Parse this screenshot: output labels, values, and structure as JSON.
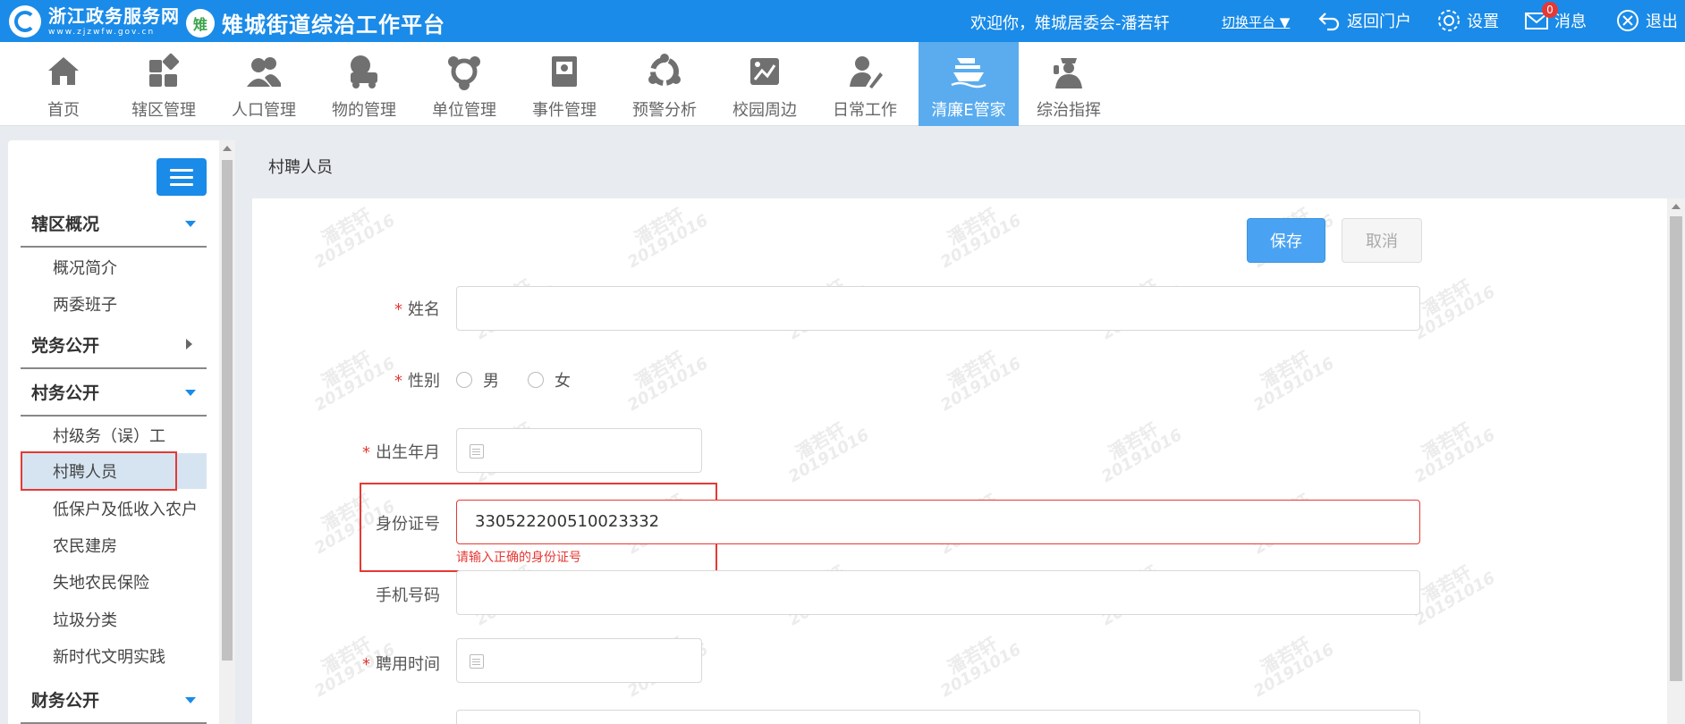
{
  "brand": {
    "logo_cn": "浙江政务服务网",
    "logo_en": "www.zjzwfw.gov.cn",
    "platform_badge": "雉",
    "platform_title": "雉城街道综治工作平台"
  },
  "topbar": {
    "welcome": "欢迎你，雉城居委会-潘若轩",
    "switch_label": "切换平台 ▼",
    "return_label": "返回门户",
    "settings_label": "设置",
    "messages_label": "消息",
    "messages_count": "0",
    "logout_label": "退出"
  },
  "nav": {
    "items": [
      {
        "label": "首页",
        "icon": "home-icon"
      },
      {
        "label": "辖区管理",
        "icon": "grid-icon"
      },
      {
        "label": "人口管理",
        "icon": "people-icon"
      },
      {
        "label": "物的管理",
        "icon": "truck-icon"
      },
      {
        "label": "单位管理",
        "icon": "network-icon"
      },
      {
        "label": "事件管理",
        "icon": "book-icon"
      },
      {
        "label": "预警分析",
        "icon": "cycle-icon"
      },
      {
        "label": "校园周边",
        "icon": "school-icon"
      },
      {
        "label": "日常工作",
        "icon": "user-edit-icon"
      },
      {
        "label": "清廉E管家",
        "icon": "ship-icon"
      },
      {
        "label": "综治指挥",
        "icon": "officer-icon"
      }
    ],
    "active_index": 9
  },
  "sidebar": {
    "sections": [
      {
        "title": "辖区概况",
        "expanded": true,
        "items": [
          "概况简介",
          "两委班子"
        ]
      },
      {
        "title": "党务公开",
        "expanded": false,
        "items": []
      },
      {
        "title": "村务公开",
        "expanded": true,
        "items": [
          "村级务（误）工",
          "村聘人员",
          "低保户及低收入农户",
          "农民建房",
          "失地农民保险",
          "垃圾分类",
          "新时代文明实践"
        ]
      },
      {
        "title": "财务公开",
        "expanded": true,
        "items": []
      }
    ],
    "selected_item": "村聘人员"
  },
  "breadcrumb": "村聘人员",
  "form": {
    "save_label": "保存",
    "cancel_label": "取消",
    "required_mark": "*",
    "name_label": "姓名",
    "name_value": "",
    "gender_label": "性别",
    "gender_options": [
      "男",
      "女"
    ],
    "birth_label": "出生年月",
    "id_label": "身份证号",
    "id_value": "330522200510023332",
    "id_error": "请输入正确的身份证号",
    "phone_label": "手机号码",
    "phone_value": "",
    "hire_label": "聘用时间"
  },
  "watermark": {
    "name": "潘若轩",
    "code": "20191016"
  },
  "colors": {
    "primary": "#1a8be8",
    "active_nav": "#5aacef",
    "error": "#e53935"
  }
}
